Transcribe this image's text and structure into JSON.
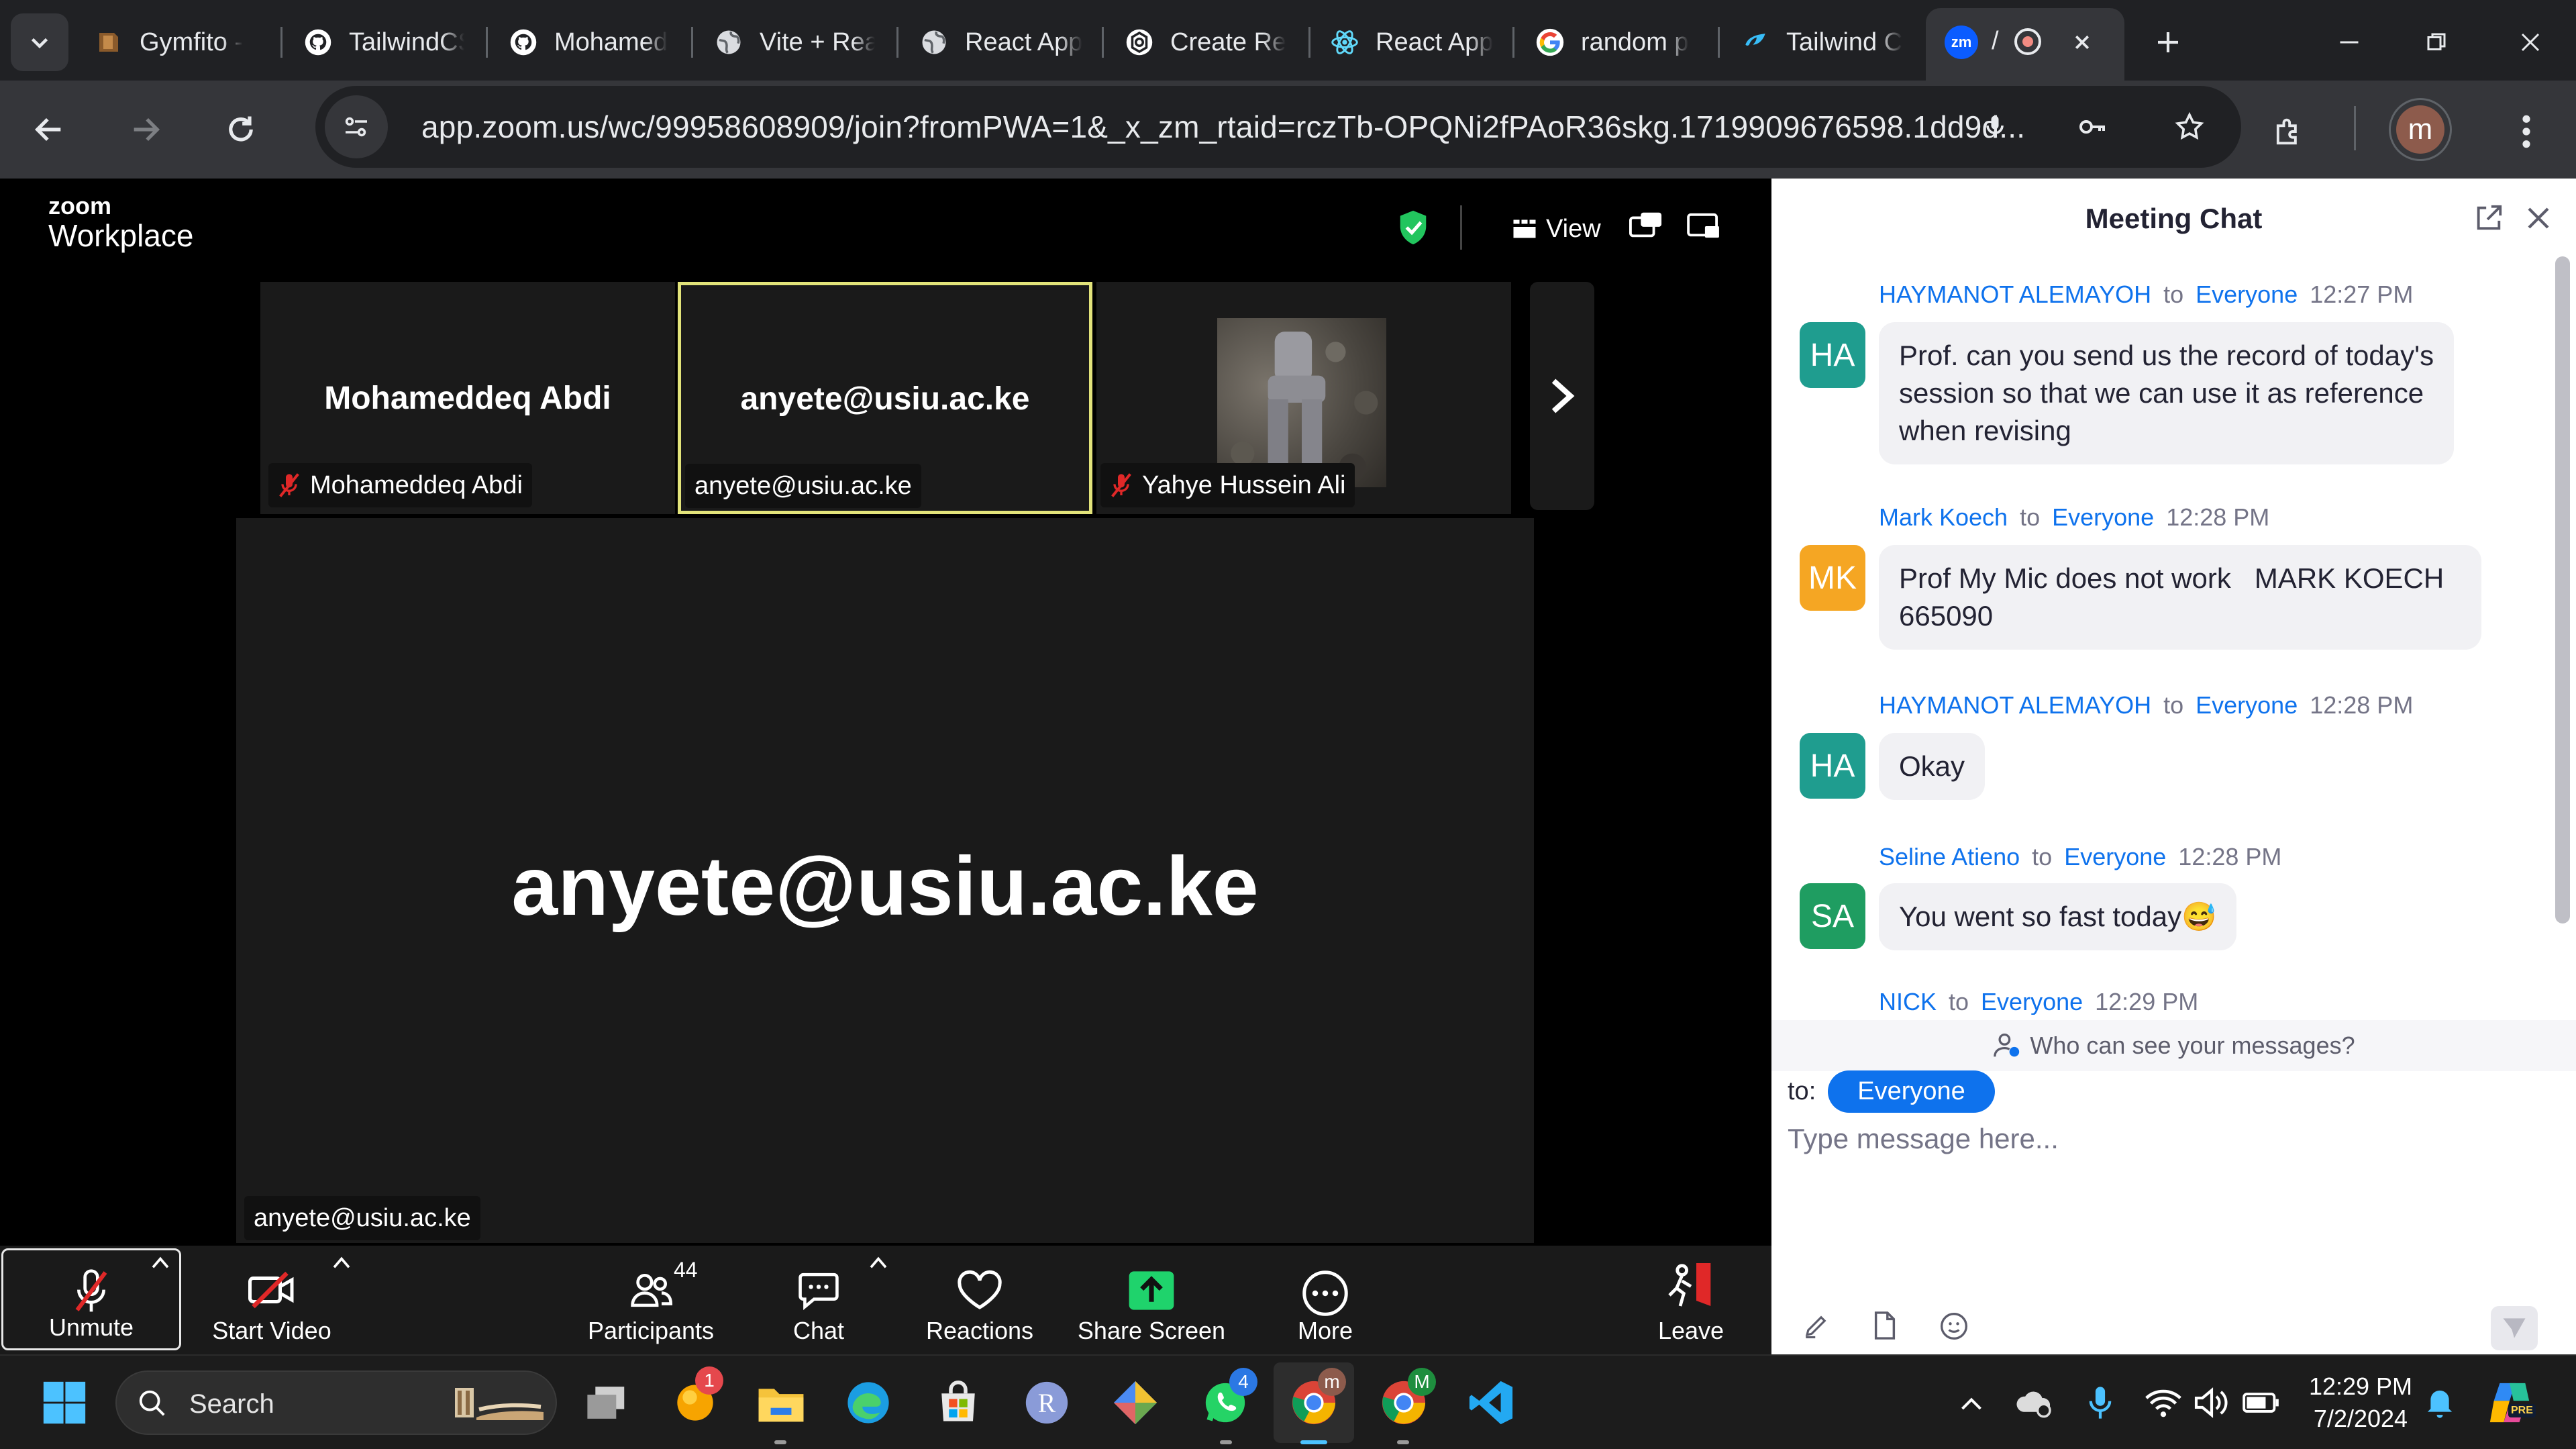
{
  "browser": {
    "tabs": [
      {
        "title": "Gymfito - ",
        "icon": "gymfito-favicon"
      },
      {
        "title": "TailwindCSS",
        "icon": "github-icon"
      },
      {
        "title": "Mohamed",
        "icon": "github-icon"
      },
      {
        "title": "Vite + React",
        "icon": "globe-icon"
      },
      {
        "title": "React App",
        "icon": "globe-icon"
      },
      {
        "title": "Create Res",
        "icon": "openai-icon"
      },
      {
        "title": "React App",
        "icon": "react-icon"
      },
      {
        "title": "random p",
        "icon": "google-icon"
      },
      {
        "title": "Tailwind C",
        "icon": "tailwind-icon"
      }
    ],
    "active_tab": {
      "icon_text": "zm",
      "title": "/"
    },
    "url": "app.zoom.us/wc/99958608909/join?fromPWA=1&_x_zm_rtaid=rczTb-OPQNi2fPAoR36skg.1719909676598.1dd9d...",
    "profile_initial": "m"
  },
  "zoom": {
    "brand_small": "zoom",
    "brand_large": "Workplace",
    "view_label": "View",
    "gallery": [
      {
        "center_name": "Mohameddeq Abdi",
        "chip": "Mohameddeq Abdi",
        "muted": true
      },
      {
        "center_name": "anyete@usiu.ac.ke",
        "chip": "anyete@usiu.ac.ke",
        "muted": false,
        "active": true
      },
      {
        "center_name": "",
        "chip": "Yahye Hussein Ali",
        "muted": true
      }
    ],
    "speaker_name": "anyete@usiu.ac.ke",
    "speaker_chip": "anyete@usiu.ac.ke",
    "controls": {
      "unmute": "Unmute",
      "start_video": "Start Video",
      "participants": "Participants",
      "participants_count": "44",
      "chat": "Chat",
      "reactions": "Reactions",
      "share_screen": "Share Screen",
      "more": "More",
      "leave": "Leave"
    }
  },
  "chat": {
    "title": "Meeting Chat",
    "to_word": "to",
    "messages": [
      {
        "initials": "HA",
        "color": "#1f9d8f",
        "name": "HAYMANOT ALEMAYOH",
        "recipient": "Everyone",
        "time": "12:27 PM",
        "lines": [
          "Prof. can you send us the record of today's",
          "session so that we can use it as reference",
          "when revising"
        ]
      },
      {
        "initials": "MK",
        "color": "#f5a623",
        "name": "Mark Koech",
        "recipient": "Everyone",
        "time": "12:28 PM",
        "lines": [
          "Prof My Mic does not work   MARK KOECH",
          "665090"
        ]
      },
      {
        "initials": "HA",
        "color": "#1f9d8f",
        "name": "HAYMANOT ALEMAYOH",
        "recipient": "Everyone",
        "time": "12:28 PM",
        "lines": [
          "Okay"
        ]
      },
      {
        "initials": "SA",
        "color": "#1f9d61",
        "name": "Seline Atieno",
        "recipient": "Everyone",
        "time": "12:28 PM",
        "lines": [
          "You went so fast today😅"
        ]
      },
      {
        "initials": "",
        "color": "#ffffff",
        "name": "NICK",
        "recipient": "Everyone",
        "time": "12:29 PM",
        "lines": []
      }
    ],
    "who_can_see": "Who can see your messages?",
    "to_label": "to:",
    "to_value": "Everyone",
    "input_placeholder": "Type message here..."
  },
  "taskbar": {
    "search_placeholder": "Search",
    "badges": {
      "notifications": "1",
      "whatsapp": "4",
      "chrome_profile": "m",
      "chrome2_profile": "M"
    },
    "time": "12:29 PM",
    "date": "7/2/2024",
    "copilot_badge": "PRE"
  }
}
